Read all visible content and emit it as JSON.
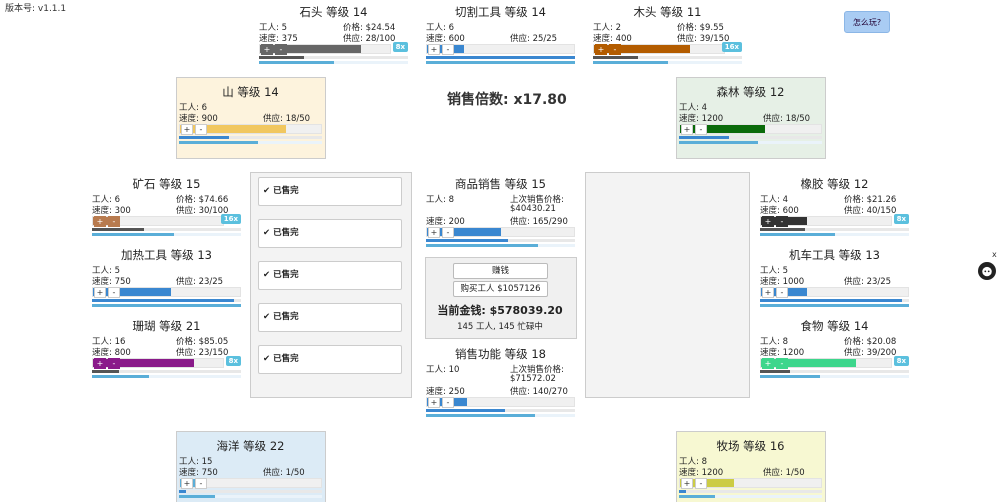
{
  "version": "版本号: v1.1.1",
  "help_button": "怎么玩?",
  "close_label": "x",
  "sell_multiplier": "销售倍数: x17.80",
  "sold_out": "已售完",
  "store": {
    "earn_label": "赚钱",
    "buy_worker_label": "购买工人 $1057126",
    "money": "当前金钱: $578039.20",
    "workers_status": "145 工人, 145 忙碌中"
  },
  "nodes": {
    "stone": {
      "title": "石头 等级 14",
      "workers": "工人: 5",
      "price": "价格: $24.54",
      "speed": "速度: 375",
      "supply": "供应: 28/100",
      "mult": "8x",
      "fill": 0.78,
      "progress": 0.3,
      "color": "#666666"
    },
    "cutting": {
      "title": "切割工具 等级 14",
      "workers": "工人: 6",
      "speed": "速度: 600",
      "supply": "供应: 25/25",
      "fill": 0.25,
      "progress": 1.0,
      "color": "#3a87d0"
    },
    "wood": {
      "title": "木头 等级 11",
      "workers": "工人: 2",
      "price": "价格: $9.55",
      "speed": "速度: 400",
      "supply": "供应: 39/150",
      "mult": "16x",
      "fill": 0.74,
      "progress": 0.3,
      "color": "#b35c00"
    },
    "mountain": {
      "title": "山 等级 14",
      "workers": "工人: 6",
      "speed": "速度: 900",
      "supply": "供应: 18/50",
      "fill": 0.75,
      "progress": 0.35,
      "color": "#f1c75f"
    },
    "forest": {
      "title": "森林 等级 12",
      "workers": "工人: 4",
      "speed": "速度: 1200",
      "supply": "供应: 18/50",
      "fill": 0.6,
      "progress": 0.35,
      "color": "#0a6b0a"
    },
    "ore": {
      "title": "矿石 等级 15",
      "workers": "工人: 6",
      "price": "价格: $74.66",
      "speed": "速度: 300",
      "supply": "供应: 30/100",
      "mult": "16x",
      "fill": 0.2,
      "progress": 0.35,
      "color": "#b87b4f"
    },
    "heating": {
      "title": "加热工具 等级 13",
      "workers": "工人: 5",
      "speed": "速度: 750",
      "supply": "供应: 23/25",
      "fill": 0.53,
      "progress": 0.95,
      "color": "#3a87d0"
    },
    "coral": {
      "title": "珊瑚 等级 21",
      "workers": "工人: 16",
      "price": "价格: $85.05",
      "speed": "速度: 800",
      "supply": "供应: 23/150",
      "mult": "8x",
      "fill": 0.78,
      "progress": 0.18,
      "color": "#8a1a8a"
    },
    "rubber": {
      "title": "橡胶 等级 12",
      "workers": "工人: 4",
      "price": "价格: $21.26",
      "speed": "速度: 600",
      "supply": "供应: 40/150",
      "mult": "8x",
      "fill": 0.35,
      "progress": 0.3,
      "color": "#333333"
    },
    "vehicle": {
      "title": "机车工具 等级 13",
      "workers": "工人: 5",
      "speed": "速度: 1000",
      "supply": "供应: 23/25",
      "fill": 0.31,
      "progress": 0.95,
      "color": "#3a87d0"
    },
    "food": {
      "title": "食物 等级 14",
      "workers": "工人: 8",
      "price": "价格: $20.08",
      "speed": "速度: 1200",
      "supply": "供应: 39/200",
      "mult": "8x",
      "fill": 0.73,
      "progress": 0.2,
      "color": "#3dd68c"
    },
    "sales": {
      "title": "商品销售 等级 15",
      "workers": "工人: 8",
      "last_price_label": "上次销售价格:",
      "last_price": "$40430.21",
      "speed": "速度: 200",
      "supply": "供应: 165/290",
      "fill": 0.5,
      "progress": 0.55,
      "color": "#3a87d0"
    },
    "sales_func": {
      "title": "销售功能 等级 18",
      "workers": "工人: 10",
      "last_price_label": "上次销售价格:",
      "last_price": "$71572.02",
      "speed": "速度: 250",
      "supply": "供应: 140/270",
      "fill": 0.27,
      "progress": 0.53,
      "color": "#3a87d0"
    },
    "ocean": {
      "title": "海洋 等级 22",
      "workers": "工人: 15",
      "speed": "速度: 750",
      "supply": "供应: 1/50",
      "fill": 0.17,
      "progress": 0.05,
      "color": "#5aaed8"
    },
    "ranch": {
      "title": "牧场 等级 16",
      "workers": "工人: 8",
      "speed": "速度: 1200",
      "supply": "供应: 1/50",
      "fill": 0.38,
      "progress": 0.05,
      "color": "#cccc44"
    }
  }
}
